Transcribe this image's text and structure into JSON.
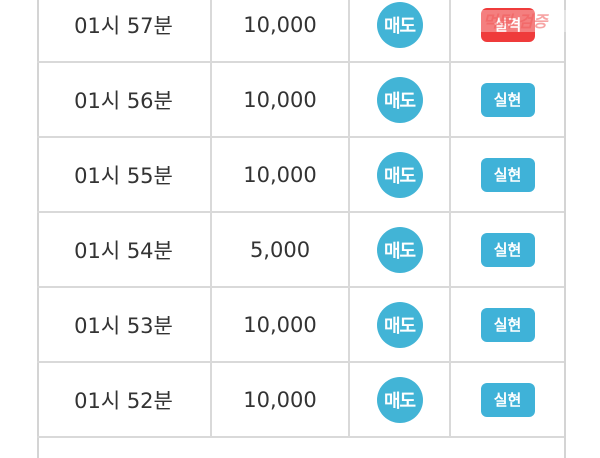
{
  "colors": {
    "sell_badge": "#42b4d6",
    "result_hit": "#3fb2d8",
    "result_miss": "#ef3b3b",
    "border": "#d9d9d9"
  },
  "rows": [
    {
      "time": "01시 57분",
      "amount": "10,000",
      "type": "매도",
      "result": "실격"
    },
    {
      "time": "01시 56분",
      "amount": "10,000",
      "type": "매도",
      "result": "실현"
    },
    {
      "time": "01시 55분",
      "amount": "10,000",
      "type": "매도",
      "result": "실현"
    },
    {
      "time": "01시 54분",
      "amount": "5,000",
      "type": "매도",
      "result": "실현"
    },
    {
      "time": "01시 53분",
      "amount": "10,000",
      "type": "매도",
      "result": "실현"
    },
    {
      "time": "01시 52분",
      "amount": "10,000",
      "type": "매도",
      "result": "실현"
    }
  ],
  "watermark": {
    "text": "먹튀 검증",
    "icon": "watermark-logo-icon"
  }
}
